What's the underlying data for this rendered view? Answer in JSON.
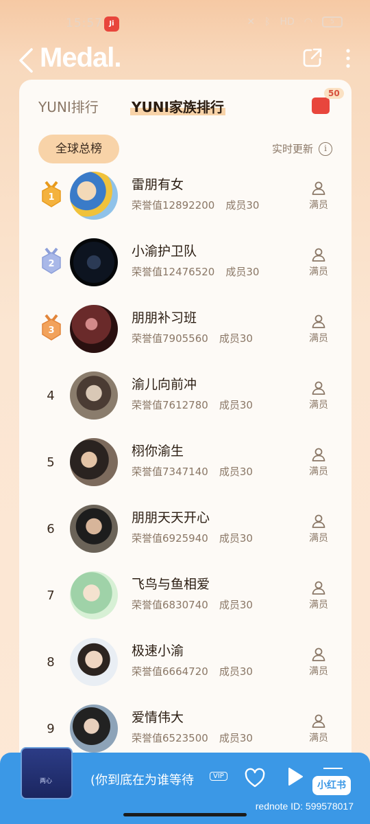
{
  "status": {
    "time": "15:57",
    "app_badge": "Ji",
    "battery": "5"
  },
  "header": {
    "title": "Medal."
  },
  "tabs": [
    {
      "label": "YUNI排行"
    },
    {
      "label": "YUNI家族排行"
    }
  ],
  "gift_badge": "50",
  "filter": {
    "label": "全球总榜"
  },
  "realtime": "实时更新",
  "honor_prefix": "荣誉值",
  "member_prefix": "成员",
  "full_label": "满员",
  "rows": [
    {
      "rank": "1",
      "name": "雷朋有女",
      "honor": "荣誉值12892200",
      "members": "成员30"
    },
    {
      "rank": "2",
      "name": "小渝护卫队",
      "honor": "荣誉值12476520",
      "members": "成员30"
    },
    {
      "rank": "3",
      "name": "朋朋补习班",
      "honor": "荣誉值7905560",
      "members": "成员30"
    },
    {
      "rank": "4",
      "name": "渝儿向前冲",
      "honor": "荣誉值7612780",
      "members": "成员30"
    },
    {
      "rank": "5",
      "name": "栩你渝生",
      "honor": "荣誉值7347140",
      "members": "成员30"
    },
    {
      "rank": "6",
      "name": "朋朋天天开心",
      "honor": "荣誉值6925940",
      "members": "成员30"
    },
    {
      "rank": "7",
      "name": "飞鸟与鱼相爱",
      "honor": "荣誉值6830740",
      "members": "成员30"
    },
    {
      "rank": "8",
      "name": "极速小渝",
      "honor": "荣誉值6664720",
      "members": "成员30"
    },
    {
      "rank": "9",
      "name": "爱情伟大",
      "honor": "荣誉值6523500",
      "members": "成员30"
    }
  ],
  "player": {
    "song": "(你到底在为谁等待",
    "vip": "VIP",
    "album_text": "两心"
  },
  "brand": "小红书",
  "rednote_id": "rednote ID: 599578017"
}
